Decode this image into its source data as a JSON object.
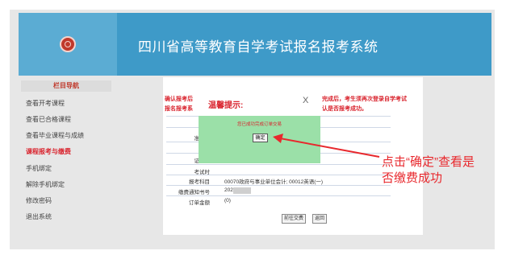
{
  "header": {
    "title": "四川省高等教育自学考试报名报考系统"
  },
  "sidebar": {
    "heading": "栏目导航",
    "items": [
      {
        "label": "查看开考课程"
      },
      {
        "label": "查看已合格课程"
      },
      {
        "label": "查看毕业课程与成绩"
      },
      {
        "label": "课程报考与缴费"
      },
      {
        "label": "手机绑定"
      },
      {
        "label": "解除手机绑定"
      },
      {
        "label": "修改密码"
      },
      {
        "label": "退出系统"
      }
    ],
    "active_index": 3
  },
  "main": {
    "notice_left_1": "确认报考后",
    "notice_left_2": "报名报考系",
    "notice_right_1": "完成后，考生须再次登录自学考试",
    "notice_right_2": "认是否报考成功。",
    "rows": [
      {
        "label": "准考证",
        "value": ""
      },
      {
        "label": "姓",
        "value": ""
      },
      {
        "label": "证件号",
        "value": ""
      },
      {
        "label": "考试时",
        "value": ""
      },
      {
        "label": "报考科目",
        "value": "00070政府与事业单位会计; 00012英语(一)"
      },
      {
        "label": "缴费通知书号",
        "value": "202"
      },
      {
        "label": "订单金额",
        "value": "(0)"
      }
    ],
    "buttons": {
      "pay": "前往交费",
      "back": "返回"
    }
  },
  "dialog": {
    "title": "温馨提示:",
    "close": "X",
    "message": "您已成功完成订单交易",
    "ok": "确定"
  },
  "annotation": {
    "line1": "点击“确定”查看是",
    "line2": "否缴费成功",
    "color": "#e8282d"
  }
}
